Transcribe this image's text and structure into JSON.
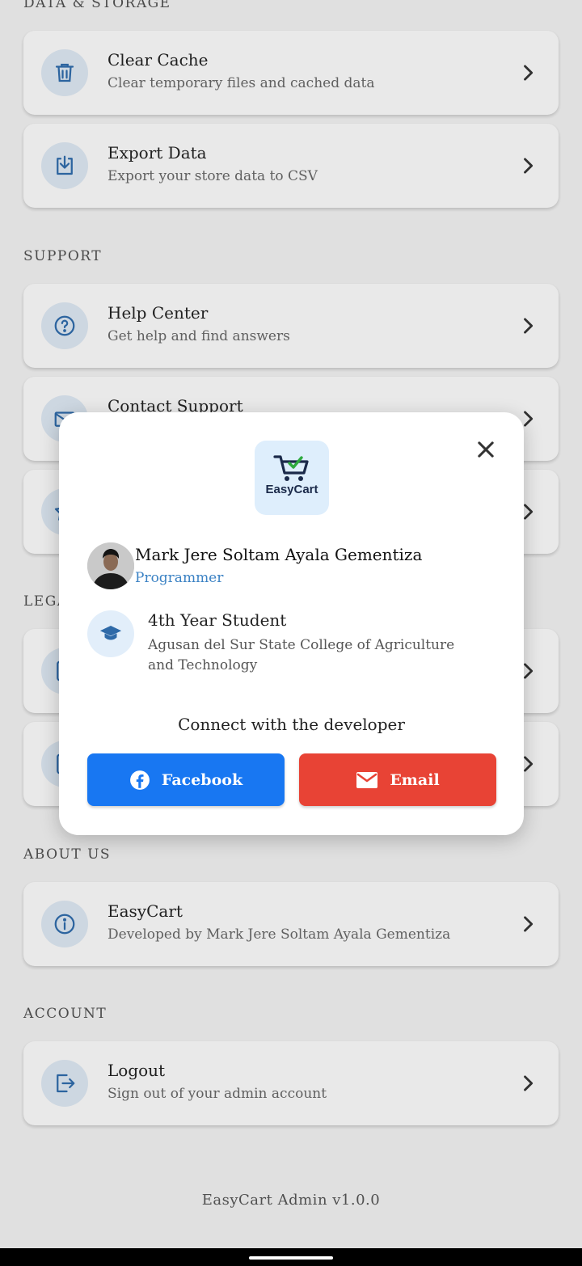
{
  "sections": {
    "data_storage": "DATA & STORAGE",
    "support": "SUPPORT",
    "legal": "LEGA",
    "about": "ABOUT US",
    "account": "ACCOUNT"
  },
  "items": {
    "clear_cache": {
      "title": "Clear Cache",
      "subtitle": "Clear temporary files and cached data"
    },
    "export_data": {
      "title": "Export Data",
      "subtitle": "Export your store data to CSV"
    },
    "help_center": {
      "title": "Help Center",
      "subtitle": "Get help and find answers"
    },
    "contact_support": {
      "title": "Contact Support"
    },
    "easycart": {
      "title": "EasyCart",
      "subtitle": "Developed by Mark Jere Soltam Ayala Gementiza"
    },
    "logout": {
      "title": "Logout",
      "subtitle": "Sign out of your admin account"
    }
  },
  "dialog": {
    "logo_text": "EasyCart",
    "developer_name": "Mark Jere Soltam Ayala Gementiza",
    "developer_role": "Programmer",
    "education_title": "4th Year Student",
    "education_school": "Agusan del Sur State College of Agriculture and Technology",
    "connect_label": "Connect with the developer",
    "facebook_label": "Facebook",
    "email_label": "Email"
  },
  "footer": {
    "version": "EasyCart Admin v1.0.0"
  },
  "colors": {
    "accent": "#3b82c4",
    "facebook": "#1877f2",
    "email": "#e84335"
  }
}
